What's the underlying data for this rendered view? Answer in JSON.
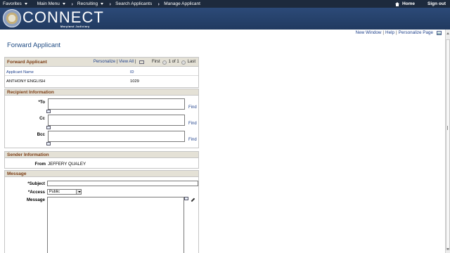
{
  "topnav": {
    "favorites": "Favorites",
    "main_menu": "Main Menu",
    "breadcrumb": [
      "Recruiting",
      "Search Applicants",
      "Manage Applicant"
    ],
    "home": "Home",
    "sign_out": "Sign out"
  },
  "banner": {
    "logo_text": "CONNECT",
    "logo_sub": "Maryland Judiciary"
  },
  "toplinks": {
    "new_window": "New Window",
    "help": "Help",
    "personalize_page": "Personalize Page"
  },
  "page_title": "Forward Applicant",
  "forward_grid": {
    "title": "Forward Applicant",
    "personalize": "Personalize",
    "view_all": "View All",
    "first": "First",
    "range": "1 of 1",
    "last": "Last",
    "columns": [
      "Applicant Name",
      "ID"
    ],
    "rows": [
      {
        "name": "ANTHONY ENGLISH",
        "id": "1029"
      }
    ]
  },
  "recipient": {
    "title": "Recipient Information",
    "to_label": "*To",
    "cc_label": "Cc",
    "bcc_label": "Bcc",
    "find": "Find",
    "to_value": "",
    "cc_value": "",
    "bcc_value": ""
  },
  "sender": {
    "title": "Sender Information",
    "from_label": "From",
    "from_value": "JEFFERY QUALEY"
  },
  "message": {
    "title": "Message",
    "subject_label": "*Subject",
    "access_label": "*Access",
    "access_value": "Public",
    "message_label": "Message",
    "subject_value": "",
    "message_value": ""
  }
}
